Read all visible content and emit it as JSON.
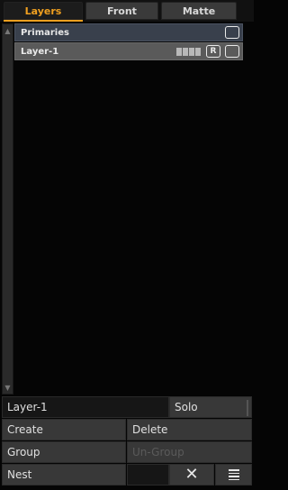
{
  "tabs": [
    {
      "label": "Layers",
      "active": true
    },
    {
      "label": "Front",
      "active": false
    },
    {
      "label": "Matte",
      "active": false
    }
  ],
  "accent_color": "#f0a020",
  "layers": {
    "primaries_label": "Primaries",
    "layer_label": "Layer-1",
    "layer_badge": "R"
  },
  "bottom": {
    "current_layer": "Layer-1",
    "solo": "Solo",
    "create": "Create",
    "delete": "Delete",
    "group": "Group",
    "ungroup": "Un-Group",
    "nest": "Nest"
  },
  "icons": {
    "scroll_up": "triangle-up-icon",
    "scroll_down": "triangle-down-icon",
    "close": "close-icon",
    "menu": "menu-icon"
  }
}
